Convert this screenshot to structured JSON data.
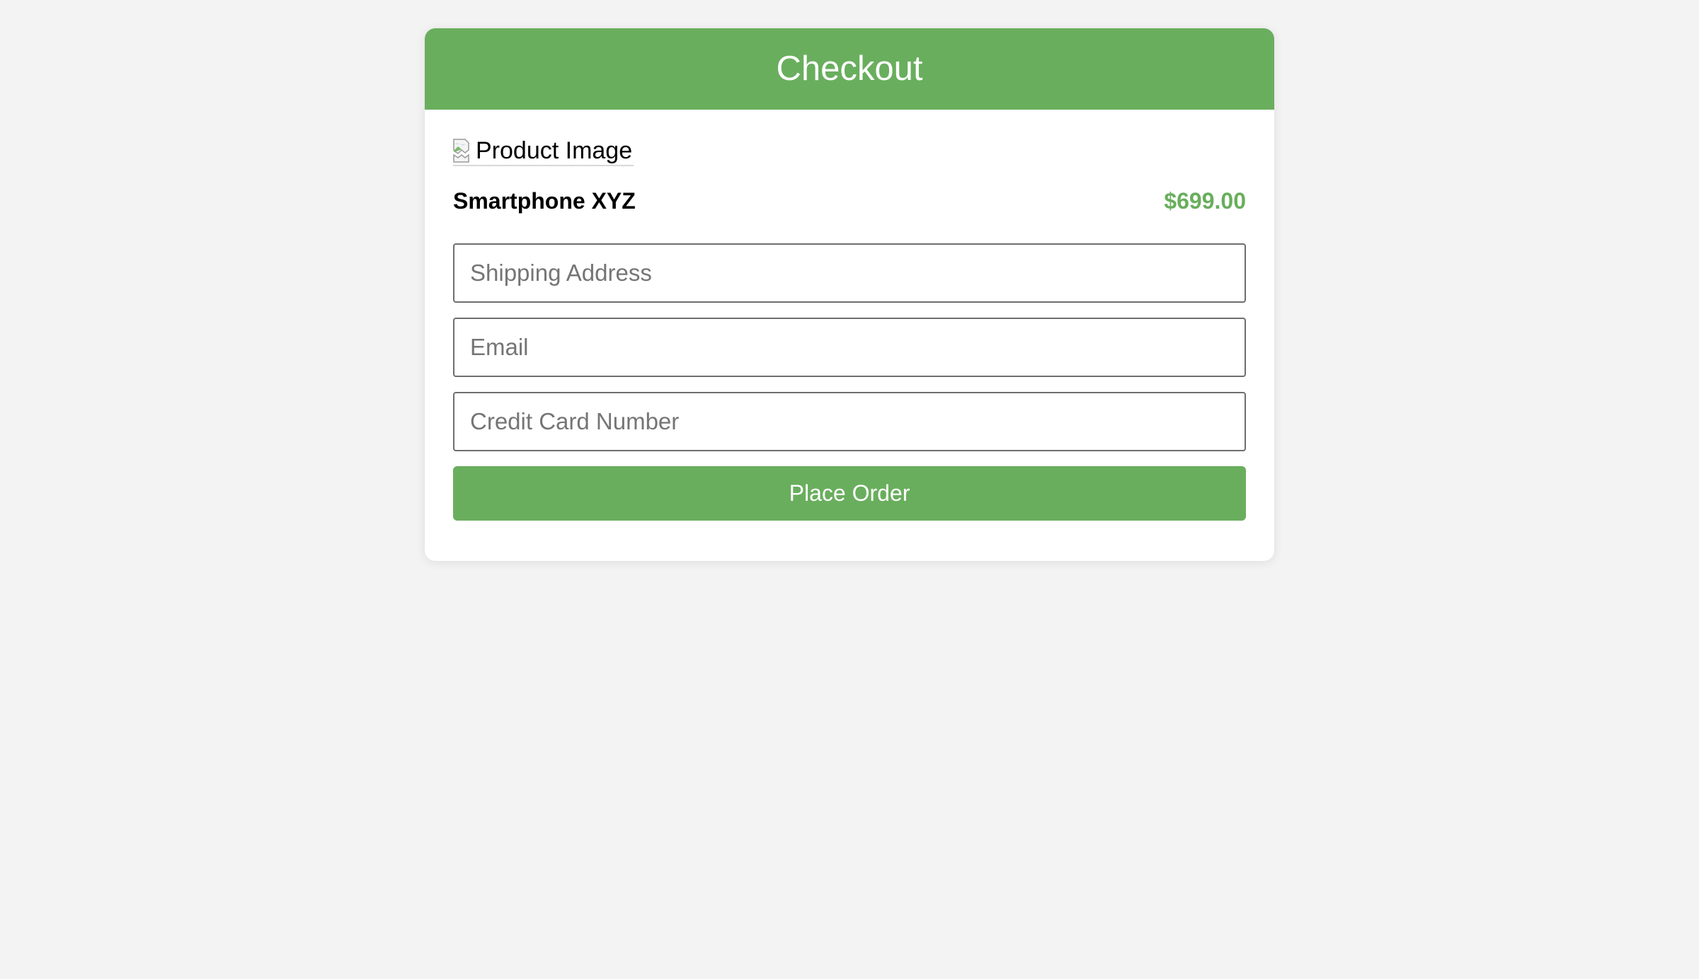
{
  "checkout": {
    "title": "Checkout"
  },
  "product": {
    "image_alt": "Product Image",
    "name": "Smartphone XYZ",
    "price": "$699.00"
  },
  "form": {
    "shipping_placeholder": "Shipping Address",
    "email_placeholder": "Email",
    "card_placeholder": "Credit Card Number",
    "submit_label": "Place Order"
  },
  "colors": {
    "accent": "#69ae5d",
    "background": "#f3f3f3",
    "card": "#ffffff"
  },
  "icons": {
    "product_image": "broken-image-icon"
  }
}
